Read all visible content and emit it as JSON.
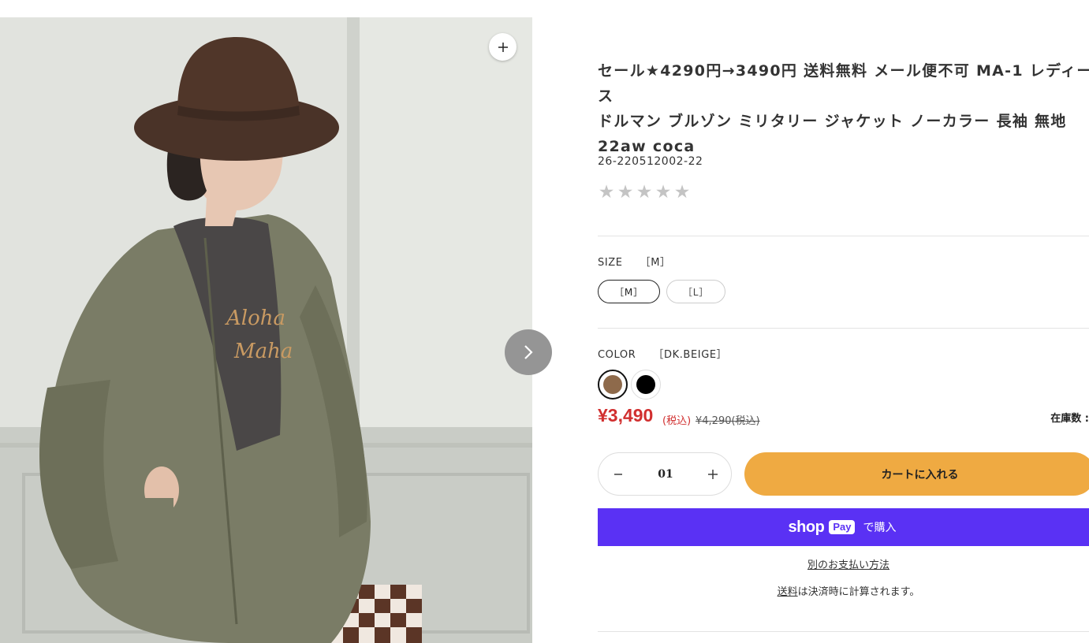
{
  "product": {
    "title": "セール★4290円→3490円 送料無料 メール便不可 MA-1 レディース\nドルマン ブルゾン ミリタリー ジャケット ノーカラー 長袖 無地\n22aw coca",
    "sku": "26-220512002-22",
    "rating_stars": 5,
    "rating_value": 0
  },
  "gallery": {
    "zoom_icon": "plus-icon",
    "next_icon": "chevron-right-icon"
  },
  "size": {
    "label": "SIZE",
    "selected": "［M］",
    "options": [
      "［M］",
      "［L］"
    ]
  },
  "color": {
    "label": "COLOR",
    "selected": "［DK.BEIGE］",
    "swatches": [
      "#8e6a4b",
      "#000000"
    ]
  },
  "price": {
    "current": "¥3,490",
    "tax_label": "(税込)",
    "original": "¥4,290(税込)",
    "stock_label": "在庫数 :"
  },
  "quantity": {
    "value": "01"
  },
  "actions": {
    "add_to_cart": "カートに入れる",
    "shop_word": "shop",
    "pay_badge": "Pay",
    "shop_suffix": "で購入",
    "alt_payment": "別のお支払い方法",
    "shipping_link": "送料",
    "shipping_note": "は決済時に計算されます。"
  },
  "colors": {
    "accent_price": "#d12f2f",
    "cart_button": "#efaa42",
    "shop_pay": "#5a31f4"
  }
}
